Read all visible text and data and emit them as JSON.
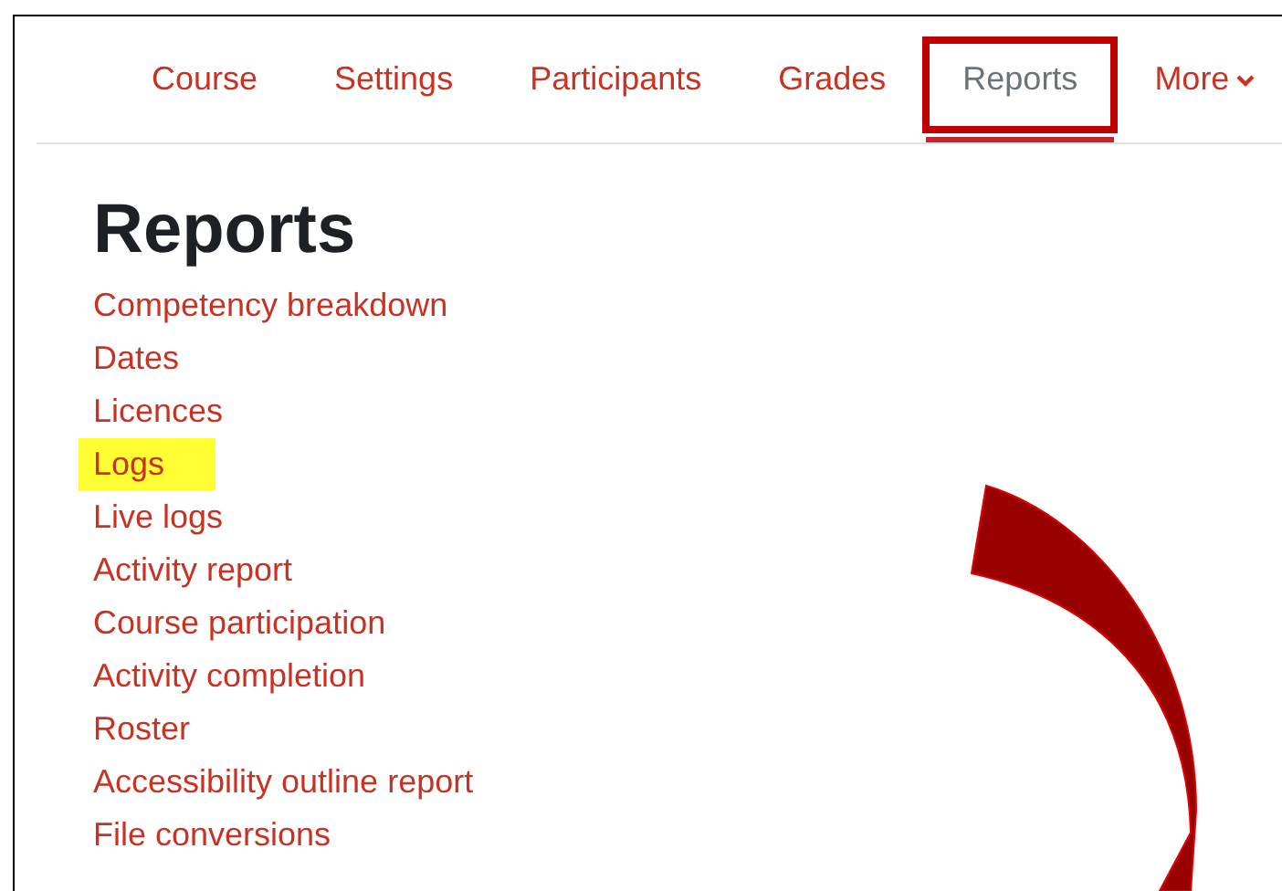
{
  "tabs": [
    {
      "label": "Course",
      "selected": false
    },
    {
      "label": "Settings",
      "selected": false
    },
    {
      "label": "Participants",
      "selected": false
    },
    {
      "label": "Grades",
      "selected": false
    },
    {
      "label": "Reports",
      "selected": true,
      "boxed": true
    },
    {
      "label": "More",
      "selected": false,
      "dropdown": true
    }
  ],
  "heading": "Reports",
  "links": [
    {
      "label": "Competency breakdown",
      "highlighted": false
    },
    {
      "label": "Dates",
      "highlighted": false
    },
    {
      "label": "Licences",
      "highlighted": false
    },
    {
      "label": "Logs",
      "highlighted": true
    },
    {
      "label": "Live logs",
      "highlighted": false
    },
    {
      "label": "Activity report",
      "highlighted": false
    },
    {
      "label": "Course participation",
      "highlighted": false
    },
    {
      "label": "Activity completion",
      "highlighted": false
    },
    {
      "label": "Roster",
      "highlighted": false
    },
    {
      "label": "Accessibility outline report",
      "highlighted": false
    },
    {
      "label": "File conversions",
      "highlighted": false
    }
  ]
}
